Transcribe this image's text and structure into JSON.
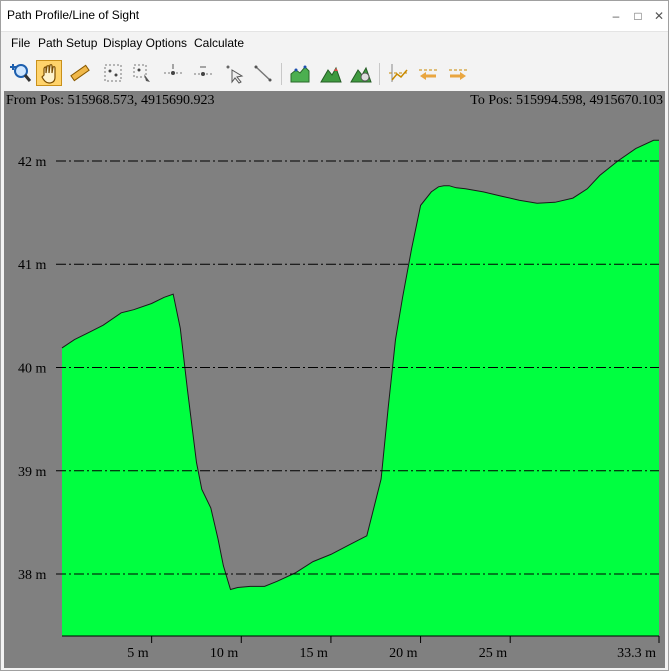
{
  "window": {
    "title": "Path Profile/Line of Sight"
  },
  "menu": [
    "File",
    "Path Setup",
    "Display Options",
    "Calculate"
  ],
  "toolbar": {
    "tools": [
      {
        "name": "zoom-tool-icon",
        "active": false
      },
      {
        "name": "pan-hand-icon",
        "active": true
      },
      {
        "name": "measure-ruler-icon",
        "active": false
      },
      {
        "name": "select-points-icon",
        "active": false
      },
      {
        "name": "select-points-alt-icon",
        "active": false
      },
      {
        "name": "add-point-icon",
        "active": false
      },
      {
        "name": "remove-point-icon",
        "active": false
      },
      {
        "name": "select-arrow-icon",
        "active": false
      },
      {
        "name": "line-tool-icon",
        "active": false
      },
      {
        "name": "profile-graph-icon",
        "active": false
      },
      {
        "name": "terrain-icon",
        "active": false
      },
      {
        "name": "terrain-settings-icon",
        "active": false
      },
      {
        "name": "line-of-sight-icon",
        "active": false
      },
      {
        "name": "reverse-left-icon",
        "active": false
      },
      {
        "name": "reverse-right-icon",
        "active": false
      }
    ]
  },
  "profile": {
    "from_pos": "From Pos: 515968.573, 4915690.923",
    "to_pos": "To Pos: 515994.598, 4915670.103",
    "fill_color": "#00ff40",
    "background_color": "#808080"
  },
  "chart_data": {
    "type": "area",
    "title": "",
    "xlabel": "",
    "ylabel": "",
    "xlim": [
      0,
      33.3
    ],
    "ylim": [
      37.4,
      42.6
    ],
    "grid": true,
    "x_ticks": [
      {
        "value": 5,
        "label": "5 m"
      },
      {
        "value": 10,
        "label": "10 m"
      },
      {
        "value": 15,
        "label": "15 m"
      },
      {
        "value": 20,
        "label": "20 m"
      },
      {
        "value": 25,
        "label": "25 m"
      },
      {
        "value": 33.3,
        "label": "33.3 m"
      }
    ],
    "y_ticks": [
      {
        "value": 38,
        "label": "38 m"
      },
      {
        "value": 39,
        "label": "39 m"
      },
      {
        "value": 40,
        "label": "40 m"
      },
      {
        "value": 41,
        "label": "41 m"
      },
      {
        "value": 42,
        "label": "42 m"
      }
    ],
    "series": [
      {
        "x": [
          0,
          0.7,
          1.5,
          2.3,
          3.3,
          4.0,
          5.0,
          5.7,
          6.2,
          6.6,
          7.0,
          7.5,
          7.8,
          8.3,
          8.7,
          9.0,
          9.4,
          9.8,
          10.5,
          11.3,
          12.0,
          13.0,
          14.0,
          15.0,
          16.0,
          17.0,
          17.8,
          18.2,
          18.6,
          19.0,
          19.5,
          20.0,
          20.6,
          21.0,
          21.3,
          21.6,
          21.8,
          22.0,
          22.5,
          23.5,
          24.5,
          25.5,
          26.5,
          27.5,
          28.5,
          29.3,
          30.0,
          31.0,
          32.0,
          33.0,
          33.3
        ],
        "y": [
          40.19,
          40.27,
          40.34,
          40.41,
          40.53,
          40.56,
          40.62,
          40.68,
          40.71,
          40.38,
          39.78,
          39.08,
          38.82,
          38.64,
          38.34,
          38.08,
          37.85,
          37.87,
          37.88,
          37.88,
          37.93,
          38.01,
          38.12,
          38.19,
          38.28,
          38.37,
          38.92,
          39.62,
          40.27,
          40.68,
          41.15,
          41.57,
          41.7,
          41.75,
          41.76,
          41.76,
          41.75,
          41.74,
          41.73,
          41.7,
          41.66,
          41.62,
          41.59,
          41.6,
          41.64,
          41.73,
          41.86,
          42.0,
          42.12,
          42.2,
          42.2
        ]
      }
    ]
  }
}
